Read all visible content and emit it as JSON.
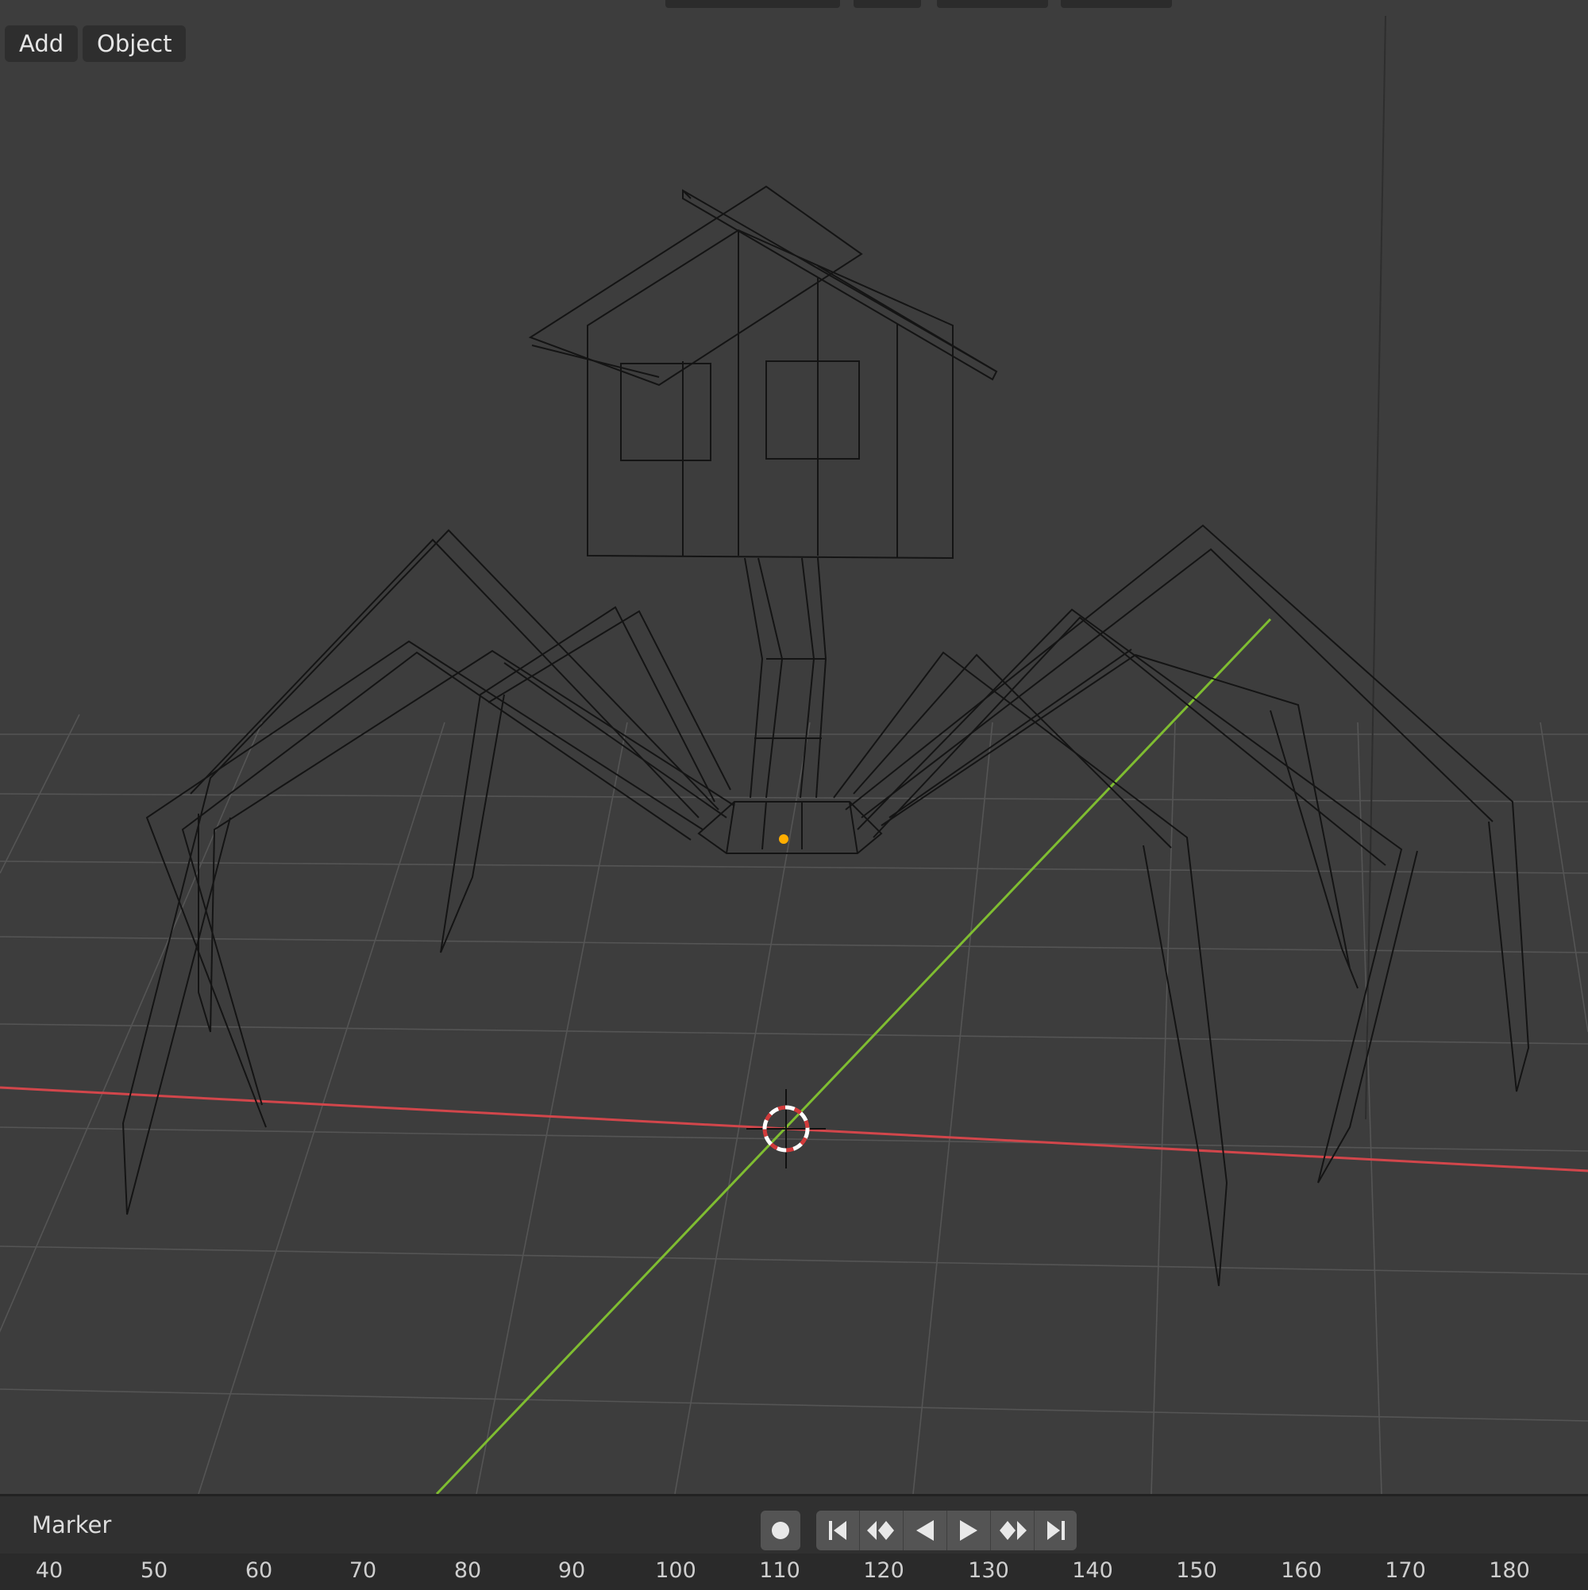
{
  "header": {
    "menus": [
      {
        "label": "Add"
      },
      {
        "label": "Object"
      }
    ]
  },
  "viewport": {
    "axis_colors": {
      "x": "#d2464b",
      "y": "#7fbd31"
    },
    "grid_color": "#545454",
    "wire_color": "#141414",
    "origin_color": "#ffae00",
    "cursor_colors": [
      "#ffffff",
      "#d23b3b"
    ]
  },
  "timeline": {
    "marker_label": "Marker",
    "controls": [
      {
        "icon": "record-icon"
      },
      {
        "icon": "jump-to-start-icon"
      },
      {
        "icon": "prev-keyframe-icon"
      },
      {
        "icon": "play-reverse-icon"
      },
      {
        "icon": "play-icon"
      },
      {
        "icon": "next-keyframe-icon"
      },
      {
        "icon": "jump-to-end-icon"
      }
    ],
    "ruler": [
      "40",
      "50",
      "60",
      "70",
      "80",
      "90",
      "100",
      "110",
      "120",
      "130",
      "140",
      "150",
      "160",
      "170",
      "180"
    ]
  }
}
